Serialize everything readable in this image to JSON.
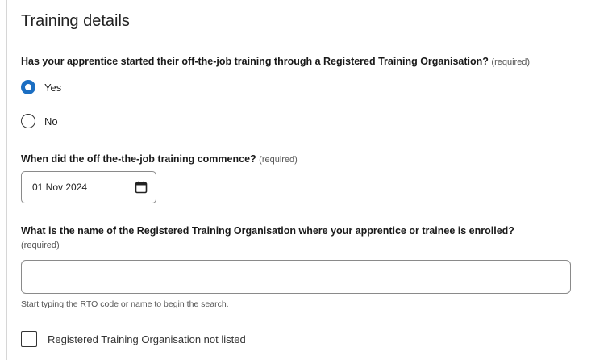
{
  "section": {
    "title": "Training details"
  },
  "q_started": {
    "label": "Has your apprentice started their off-the-job training through a Registered Training Organisation?",
    "required": "(required)",
    "options": [
      {
        "label": "Yes",
        "selected": true
      },
      {
        "label": "No",
        "selected": false
      }
    ]
  },
  "q_commence": {
    "label": "When did the off the-the-job training commence?",
    "required": "(required)",
    "value": "01 Nov 2024",
    "icon": "calendar-icon"
  },
  "q_rto": {
    "label": "What is the name of the Registered Training Organisation where your apprentice or trainee is enrolled?",
    "required": "(required)",
    "value": "",
    "hint": "Start typing the RTO code or name to begin the search."
  },
  "rto_not_listed": {
    "label": "Registered Training Organisation not listed",
    "checked": false
  },
  "colors": {
    "accent": "#1b6ec2",
    "border": "#8a8a8a",
    "text": "#1a1a1a"
  }
}
